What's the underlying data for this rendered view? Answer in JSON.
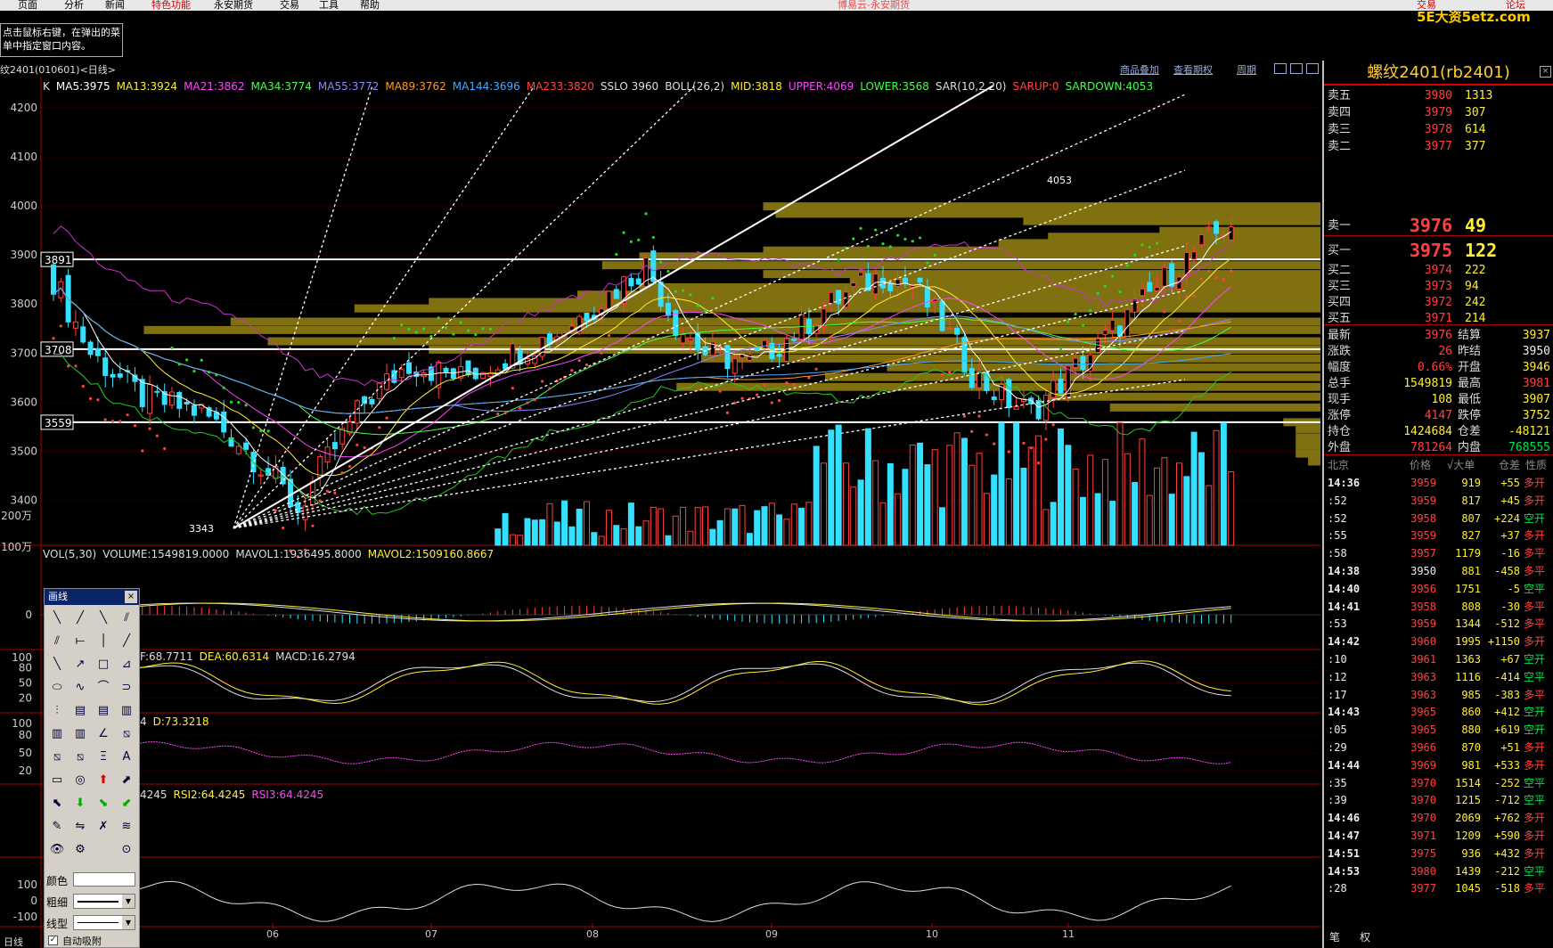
{
  "app_title": "博易云-永安期货",
  "menu": [
    "页面",
    "分析",
    "新闻",
    "特色功能",
    "永安期货",
    "交易",
    "工具",
    "帮助"
  ],
  "watermark": "5E大资5etz.com",
  "top_right": [
    "交易",
    "论坛"
  ],
  "hint": "点击鼠标右键，在弹出的菜单中指定窗口内容。",
  "chart_header": {
    "symbol": "纹2401(010601)<日线>",
    "links": [
      "商品叠加",
      "查看期权",
      "周期"
    ]
  },
  "indicator_line": [
    {
      "t": "K",
      "c": "#ddd"
    },
    {
      "t": "MA5:3975",
      "c": "#ffffff"
    },
    {
      "t": "MA13:3924",
      "c": "#ffee33"
    },
    {
      "t": "MA21:3862",
      "c": "#ff44ff"
    },
    {
      "t": "MA34:3774",
      "c": "#44ff44"
    },
    {
      "t": "MA55:3772",
      "c": "#8888ff"
    },
    {
      "t": "MA89:3762",
      "c": "#ff9922"
    },
    {
      "t": "MA144:3696",
      "c": "#44aaff"
    },
    {
      "t": "MA233:3820",
      "c": "#ff4444"
    },
    {
      "t": "SSLO 3960",
      "c": "#ddd"
    },
    {
      "t": "BOLL(26,2)",
      "c": "#ddd"
    },
    {
      "t": "MID:3818",
      "c": "#ffee33"
    },
    {
      "t": "UPPER:4069",
      "c": "#ff44ff"
    },
    {
      "t": "LOWER:3568",
      "c": "#44ff44"
    },
    {
      "t": "SAR(10,2,20)",
      "c": "#ddd"
    },
    {
      "t": "SARUP:0",
      "c": "#ff4444"
    },
    {
      "t": "SARDOWN:4053",
      "c": "#44ff44"
    }
  ],
  "price_axis": [
    "4200",
    "4100",
    "4000",
    "3900",
    "3800",
    "3700",
    "3600",
    "3500",
    "3400"
  ],
  "price_boxes": [
    "3891",
    "3708",
    "3559"
  ],
  "annotations": {
    "high": "4053",
    "low": "3343"
  },
  "vol_legend": [
    {
      "t": "VOL(5,30)",
      "c": "#ddd"
    },
    {
      "t": "VOLUME:1549819.0000",
      "c": "#ddd"
    },
    {
      "t": "MAVOL1:1936495.8000",
      "c": "#ddd"
    },
    {
      "t": "MAVOL2:1509160.8667",
      "c": "#ffee33"
    }
  ],
  "vol_axis": [
    "200万",
    "100万"
  ],
  "macd_legend": [
    {
      "t": "F:68.7711",
      "c": "#ddd"
    },
    {
      "t": "DEA:60.6314",
      "c": "#ffee33"
    },
    {
      "t": "MACD:16.2794",
      "c": "#ddd"
    }
  ],
  "macd_axis": [
    "0"
  ],
  "kdj_legend": [
    {
      "t": "4",
      "c": "#ddd"
    },
    {
      "t": "D:73.3218",
      "c": "#ffee33"
    }
  ],
  "kdj_axis": [
    "100",
    "80",
    "50",
    "20"
  ],
  "rsi_legend": [
    {
      "t": "4245",
      "c": "#ddd"
    },
    {
      "t": "RSI2:64.4245",
      "c": "#ffee33"
    },
    {
      "t": "RSI3:64.4245",
      "c": "#ff44ff"
    }
  ],
  "rsi_axis": [
    "100",
    "80",
    "50",
    "20"
  ],
  "cci_axis": [
    "100",
    "0",
    "-100"
  ],
  "x_axis": [
    "06",
    "07",
    "08",
    "09",
    "10",
    "11"
  ],
  "bottom_label": "日线",
  "draw_panel": {
    "title": "画线",
    "color_label": "颜色",
    "width_label": "粗细",
    "style_label": "线型",
    "auto_label": "自动吸附"
  },
  "quote": {
    "title": "螺纹2401(rb2401)",
    "asks": [
      {
        "l": "卖五",
        "p": "3980",
        "v": "1313"
      },
      {
        "l": "卖四",
        "p": "3979",
        "v": "307"
      },
      {
        "l": "卖三",
        "p": "3978",
        "v": "614"
      },
      {
        "l": "卖二",
        "p": "3977",
        "v": "377"
      },
      {
        "l": "卖一",
        "p": "3976",
        "v": "49"
      }
    ],
    "bids": [
      {
        "l": "买一",
        "p": "3975",
        "v": "122"
      },
      {
        "l": "买二",
        "p": "3974",
        "v": "222"
      },
      {
        "l": "买三",
        "p": "3973",
        "v": "94"
      },
      {
        "l": "买四",
        "p": "3972",
        "v": "242"
      },
      {
        "l": "买五",
        "p": "3971",
        "v": "214"
      }
    ],
    "stats": [
      {
        "a": "最新",
        "b": "3976",
        "bc": "red",
        "c": "结算",
        "d": "3937",
        "dc": "yel"
      },
      {
        "a": "涨跌",
        "b": "26",
        "bc": "red",
        "c": "昨结",
        "d": "3950",
        "dc": "wht"
      },
      {
        "a": "幅度",
        "b": "0.66%",
        "bc": "red",
        "c": "开盘",
        "d": "3946",
        "dc": "yel"
      },
      {
        "a": "总手",
        "b": "1549819",
        "bc": "yel",
        "c": "最高",
        "d": "3981",
        "dc": "red"
      },
      {
        "a": "现手",
        "b": "108",
        "bc": "yel",
        "c": "最低",
        "d": "3907",
        "dc": "yel"
      },
      {
        "a": "涨停",
        "b": "4147",
        "bc": "red",
        "c": "跌停",
        "d": "3752",
        "dc": "yel"
      },
      {
        "a": "持仓",
        "b": "1424684",
        "bc": "yel",
        "c": "仓差",
        "d": "-48121",
        "dc": "yel"
      },
      {
        "a": "外盘",
        "b": "781264",
        "bc": "red",
        "c": "内盘",
        "d": "768555",
        "dc": "grn"
      }
    ],
    "tick_header": [
      "北京",
      "价格",
      "√大单",
      "仓差",
      "性质"
    ],
    "ticks": [
      {
        "t": "14:36",
        "p": "3959",
        "v": "919",
        "d": "+55",
        "n": "多开",
        "nc": "red",
        "pc": "red",
        "tb": true
      },
      {
        "t": ":52",
        "p": "3959",
        "v": "817",
        "d": "+45",
        "n": "多开",
        "nc": "red",
        "pc": "red",
        "tb": false
      },
      {
        "t": ":52",
        "p": "3958",
        "v": "807",
        "d": "+224",
        "n": "空开",
        "nc": "grn",
        "pc": "red",
        "tb": false
      },
      {
        "t": ":55",
        "p": "3959",
        "v": "827",
        "d": "+37",
        "n": "多开",
        "nc": "red",
        "pc": "red",
        "tb": false
      },
      {
        "t": ":58",
        "p": "3957",
        "v": "1179",
        "d": "-16",
        "n": "多平",
        "nc": "red",
        "pc": "red",
        "tb": false
      },
      {
        "t": "14:38",
        "p": "3950",
        "v": "881",
        "d": "-458",
        "n": "多平",
        "nc": "red",
        "pc": "wht",
        "tb": true
      },
      {
        "t": "14:40",
        "p": "3956",
        "v": "1751",
        "d": "-5",
        "n": "空平",
        "nc": "grn",
        "pc": "red",
        "tb": true
      },
      {
        "t": "14:41",
        "p": "3958",
        "v": "808",
        "d": "-30",
        "n": "多平",
        "nc": "red",
        "pc": "red",
        "tb": true
      },
      {
        "t": ":53",
        "p": "3959",
        "v": "1344",
        "d": "-512",
        "n": "多平",
        "nc": "red",
        "pc": "red",
        "tb": false
      },
      {
        "t": "14:42",
        "p": "3960",
        "v": "1995",
        "d": "+1150",
        "n": "多开",
        "nc": "red",
        "pc": "red",
        "tb": true
      },
      {
        "t": ":10",
        "p": "3961",
        "v": "1363",
        "d": "+67",
        "n": "空开",
        "nc": "grn",
        "pc": "red",
        "tb": false
      },
      {
        "t": ":12",
        "p": "3963",
        "v": "1116",
        "d": "-414",
        "n": "空平",
        "nc": "grn",
        "pc": "red",
        "tb": false
      },
      {
        "t": ":17",
        "p": "3963",
        "v": "985",
        "d": "-383",
        "n": "多平",
        "nc": "red",
        "pc": "red",
        "tb": false
      },
      {
        "t": "14:43",
        "p": "3965",
        "v": "860",
        "d": "+412",
        "n": "空开",
        "nc": "grn",
        "pc": "red",
        "tb": true
      },
      {
        "t": ":05",
        "p": "3965",
        "v": "880",
        "d": "+619",
        "n": "空开",
        "nc": "grn",
        "pc": "red",
        "tb": false
      },
      {
        "t": ":29",
        "p": "3966",
        "v": "870",
        "d": "+51",
        "n": "多开",
        "nc": "red",
        "pc": "red",
        "tb": false
      },
      {
        "t": "14:44",
        "p": "3969",
        "v": "981",
        "d": "+533",
        "n": "多开",
        "nc": "red",
        "pc": "red",
        "tb": true
      },
      {
        "t": ":35",
        "p": "3970",
        "v": "1514",
        "d": "-252",
        "n": "空平",
        "nc": "grn",
        "pc": "red",
        "tb": false
      },
      {
        "t": ":39",
        "p": "3970",
        "v": "1215",
        "d": "-712",
        "n": "空平",
        "nc": "grn",
        "pc": "red",
        "tb": false
      },
      {
        "t": "14:46",
        "p": "3970",
        "v": "2069",
        "d": "+762",
        "n": "多开",
        "nc": "red",
        "pc": "red",
        "tb": true
      },
      {
        "t": "14:47",
        "p": "3971",
        "v": "1209",
        "d": "+590",
        "n": "多开",
        "nc": "red",
        "pc": "red",
        "tb": true
      },
      {
        "t": "14:51",
        "p": "3975",
        "v": "936",
        "d": "+432",
        "n": "多开",
        "nc": "red",
        "pc": "red",
        "tb": true
      },
      {
        "t": "14:53",
        "p": "3980",
        "v": "1439",
        "d": "-212",
        "n": "空平",
        "nc": "grn",
        "pc": "red",
        "tb": true
      },
      {
        "t": ":28",
        "p": "3977",
        "v": "1045",
        "d": "-518",
        "n": "多平",
        "nc": "red",
        "pc": "red",
        "tb": false
      }
    ],
    "bottom_tabs": [
      "笔",
      "权"
    ]
  },
  "colors": {
    "up": "#ff4040",
    "down": "#33e0ff",
    "bg": "#000000",
    "grid": "#7a0000",
    "volbox": "#807010"
  }
}
